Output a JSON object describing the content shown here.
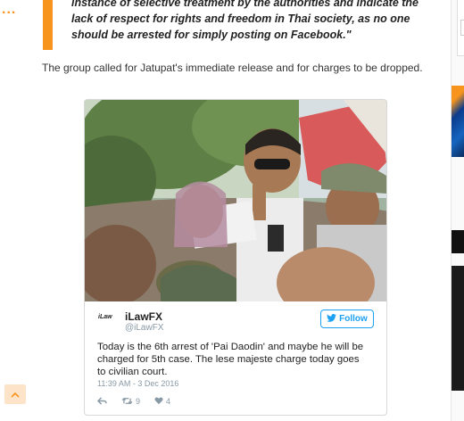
{
  "quote": {
    "dots": "...",
    "text": "instance of selective treatment by the authorities and indicate the lack of respect for rights and freedom in Thai society, as no one should be arrested for simply posting on Facebook.\""
  },
  "article": {
    "paragraph": "The group called for Jatupat's immediate release and for charges to be dropped."
  },
  "tweet": {
    "logo_text": "iLaw",
    "name": "iLawFX",
    "handle": "@iLawFX",
    "follow_label": "Follow",
    "text": "Today is the 6th arrest of 'Pai Daodin' and maybe he will be charged for 5th case. The lese majeste charge today goes to civilian court.",
    "timestamp": "11:39 AM - 3 Dec 2016",
    "retweets": "9",
    "likes": "4"
  },
  "icons": {
    "twitter_bird": "twitter-bird-icon",
    "reply": "reply-icon",
    "retweet": "retweet-icon",
    "like": "heart-icon",
    "scroll_top": "chevron-up-icon"
  },
  "colors": {
    "accent": "#f7941d",
    "twitter_blue": "#1da1f2",
    "muted": "#8899a6"
  }
}
